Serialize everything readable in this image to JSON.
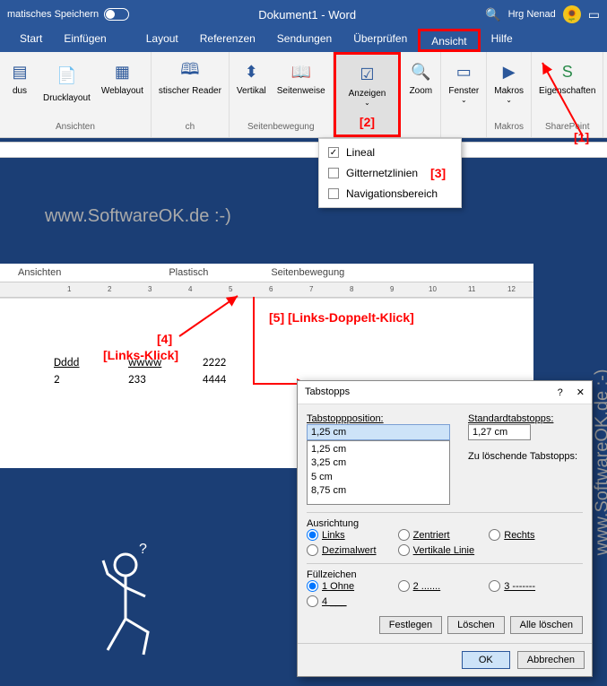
{
  "titlebar": {
    "autosave": "matisches Speichern",
    "doc": "Dokument1 - Word",
    "user": "Hrg Nenad"
  },
  "tabs": [
    "Start",
    "Einfügen",
    "Layout",
    "Referenzen",
    "Sendungen",
    "Überprüfen",
    "Ansicht",
    "Hilfe"
  ],
  "ribbon": {
    "groups": [
      {
        "label": "Ansichten",
        "items": [
          {
            "label": "dus"
          },
          {
            "label": "Drucklayout"
          },
          {
            "label": "Weblayout"
          }
        ]
      },
      {
        "label": "ch",
        "items": [
          {
            "label": "stischer Reader"
          }
        ]
      },
      {
        "label": "Seitenbewegung",
        "items": [
          {
            "label": "Vertikal"
          },
          {
            "label": "Seitenweise"
          }
        ]
      },
      {
        "label": "",
        "items": [
          {
            "label": "Anzeigen"
          }
        ]
      },
      {
        "label": "",
        "items": [
          {
            "label": "Zoom"
          }
        ]
      },
      {
        "label": "",
        "items": [
          {
            "label": "Fenster"
          }
        ]
      },
      {
        "label": "Makros",
        "items": [
          {
            "label": "Makros"
          }
        ]
      },
      {
        "label": "SharePoint",
        "items": [
          {
            "label": "Eigenschaften"
          }
        ]
      }
    ]
  },
  "anzeigen_menu": {
    "items": [
      "Lineal",
      "Gitternetzlinien",
      "Navigationsbereich"
    ],
    "checked": [
      true,
      false,
      false
    ]
  },
  "annotations": {
    "a1": "[1]",
    "a2": "[2]",
    "a3": "[3]",
    "a4": "[4]",
    "a4b": "[Links-Klick]",
    "a5": "[5]",
    "a5b": "[Links-Doppelt-Klick]"
  },
  "watermark": "www.SoftwareOK.de :-)",
  "section2_tabs": [
    "Ansichten",
    "Plastisch",
    "Seitenbewegung"
  ],
  "ruler_numbers": [
    "1",
    "2",
    "3",
    "4",
    "5",
    "6",
    "7",
    "8",
    "9",
    "10",
    "11",
    "12"
  ],
  "doc_content": [
    [
      "Dddd",
      "wwww",
      "2222"
    ],
    [
      "2",
      "233",
      "4444"
    ]
  ],
  "dialog": {
    "title": "Tabstopps",
    "pos_label": "Tabstoppposition:",
    "pos_value": "1,25 cm",
    "std_label": "Standardtabstopps:",
    "std_value": "1,27 cm",
    "delete_label": "Zu löschende Tabstopps:",
    "list": [
      "1,25 cm",
      "3,25 cm",
      "5 cm",
      "8,75 cm"
    ],
    "align_label": "Ausrichtung",
    "align_opts": [
      "Links",
      "Zentriert",
      "Rechts",
      "Dezimalwert",
      "Vertikale Linie"
    ],
    "fill_label": "Füllzeichen",
    "fill_opts": [
      "1 Ohne",
      "2 .......",
      "3 -------",
      "4 ___"
    ],
    "btn_set": "Festlegen",
    "btn_del": "Löschen",
    "btn_delall": "Alle löschen",
    "btn_ok": "OK",
    "btn_cancel": "Abbrechen"
  }
}
